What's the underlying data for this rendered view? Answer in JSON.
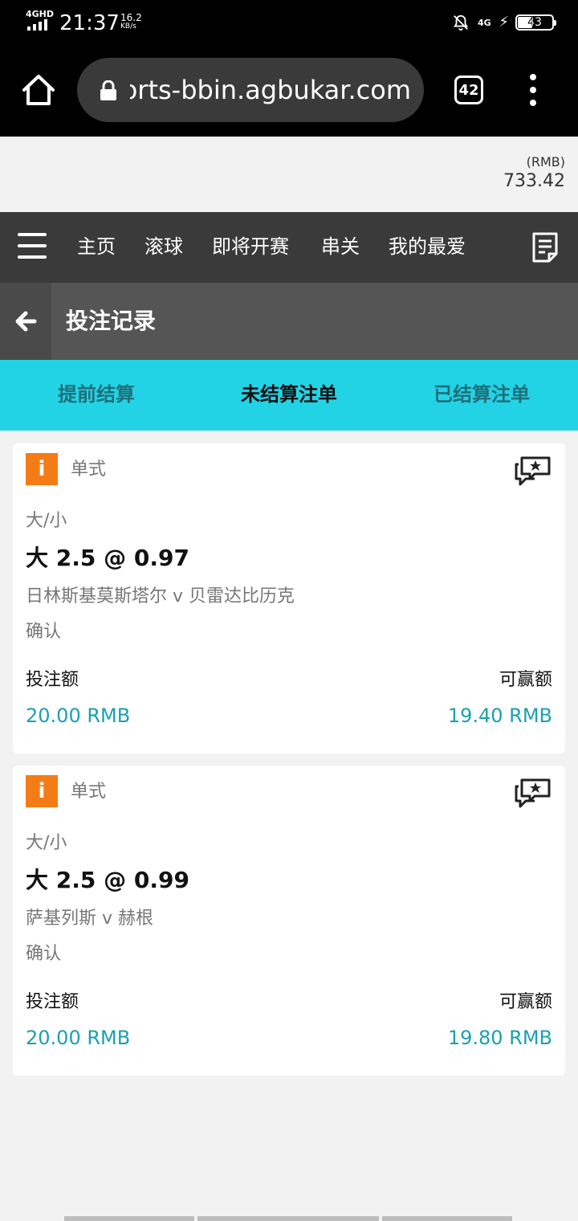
{
  "status_bar": {
    "network": "4GHD",
    "time": "21:37",
    "speed_value": "16.2",
    "speed_unit": "KB/s",
    "network_right": "4G",
    "battery_level": "43"
  },
  "browser": {
    "url": "sports-bbin.agbukar.com",
    "tab_count": "42",
    "icons": [
      "home-icon",
      "lock-icon",
      "tabs-icon",
      "more-vert-icon"
    ]
  },
  "balance": {
    "currency": "(RMB)",
    "amount": "733.42"
  },
  "nav": {
    "items": [
      {
        "label": "主页"
      },
      {
        "label": "滚球"
      },
      {
        "label": "即将开赛"
      },
      {
        "label": "串关"
      },
      {
        "label": "我的最爱"
      }
    ]
  },
  "page": {
    "title": "投注记录"
  },
  "tabs": [
    {
      "label": "提前结算"
    },
    {
      "label": "未结算注单"
    },
    {
      "label": "已结算注单"
    }
  ],
  "bets": [
    {
      "badge": "i",
      "type": "单式",
      "market": "大/小",
      "selection": "大 2.5 @ 0.97",
      "match": "日林斯基莫斯塔尔 v 贝雷达比历克",
      "status": "确认",
      "stake_label": "投注额",
      "stake": "20.00 RMB",
      "win_label": "可赢额",
      "win": "19.40 RMB"
    },
    {
      "badge": "i",
      "type": "单式",
      "market": "大/小",
      "selection": "大 2.5 @ 0.99",
      "match": "萨基列斯 v 赫根",
      "status": "确认",
      "stake_label": "投注额",
      "stake": "20.00 RMB",
      "win_label": "可赢额",
      "win": "19.80 RMB"
    }
  ],
  "colors": {
    "accent": "#22d3e6",
    "badge": "#f47c16",
    "amount": "#1aa0b0",
    "nav_bg": "#3a3a3a"
  }
}
